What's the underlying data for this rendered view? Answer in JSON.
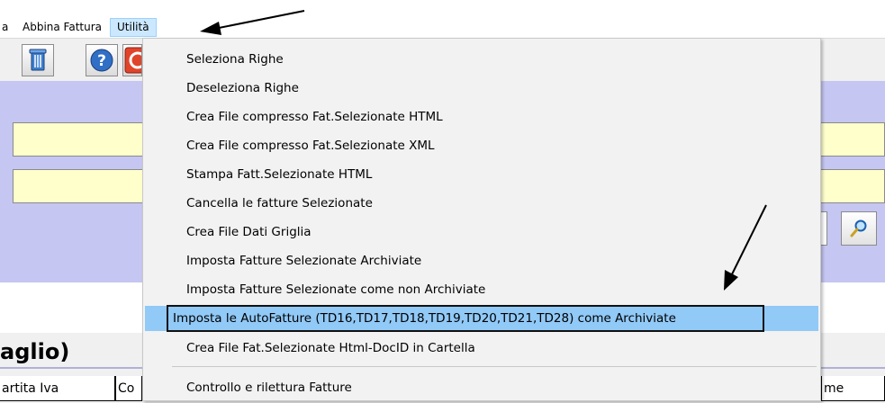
{
  "menubar": {
    "items": [
      {
        "label": "a",
        "active": false
      },
      {
        "label": "Abbina Fattura",
        "active": false
      },
      {
        "label": "Utilità",
        "active": true
      }
    ]
  },
  "toolbar": {
    "icons": [
      "trash-icon",
      "help-icon",
      "close-icon"
    ]
  },
  "dropdown": {
    "items": [
      {
        "label": "Seleziona Righe"
      },
      {
        "label": "Deseleziona Righe"
      },
      {
        "label": "Crea File compresso Fat.Selezionate HTML"
      },
      {
        "label": "Crea File compresso Fat.Selezionate XML"
      },
      {
        "label": "Stampa Fatt.Selezionate HTML"
      },
      {
        "label": "Cancella le fatture Selezionate"
      },
      {
        "label": "Crea File Dati Griglia"
      },
      {
        "label": "Imposta Fatture Selezionate Archiviate"
      },
      {
        "label": "Imposta Fatture Selezionate come non Archiviate"
      },
      {
        "label": "Imposta le AutoFatture (TD16,TD17,TD18,TD19,TD20,TD21,TD28) come Archiviate",
        "highlighted": true
      },
      {
        "label": "Crea File Fat.Selezionate Html-DocID in Cartella"
      },
      {
        "label": "Controllo e rilettura Fatture"
      }
    ]
  },
  "detail": {
    "title": "aglio)"
  },
  "grid": {
    "columns": [
      "artita Iva",
      "Co",
      "me"
    ]
  },
  "colors": {
    "panel": "#c6c6f2",
    "field_yellow": "#ffffcc",
    "menu_highlight": "#91c9f7",
    "menubar_active": "#cce8ff"
  }
}
